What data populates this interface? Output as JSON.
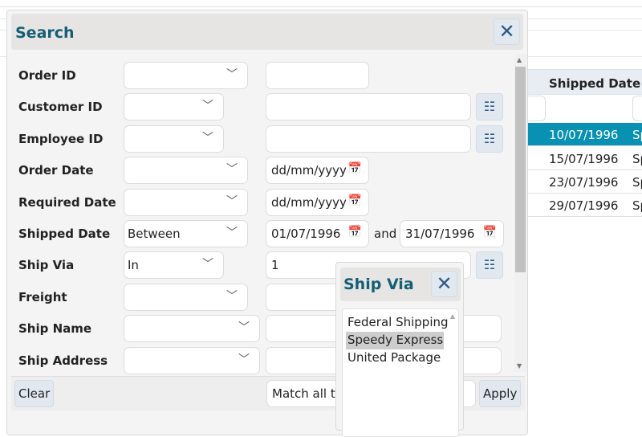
{
  "grid": {
    "header": "Shipped Date Sh",
    "rows": [
      {
        "shipped": "10/07/1996",
        "via": "Sp",
        "selected": true
      },
      {
        "shipped": "15/07/1996",
        "via": "Sp"
      },
      {
        "shipped": "23/07/1996",
        "via": "Sp"
      },
      {
        "shipped": "29/07/1996",
        "via": "Sp"
      }
    ],
    "selected_color": "#0891b2"
  },
  "search": {
    "title": "Search",
    "close_icon": "close-icon",
    "fields": [
      {
        "label": "Order ID",
        "operator": "",
        "value": ""
      },
      {
        "label": "Customer ID",
        "operator": "",
        "value": ""
      },
      {
        "label": "Employee ID",
        "operator": "",
        "value": ""
      },
      {
        "label": "Order Date",
        "operator": "",
        "value": "dd/mm/yyyy"
      },
      {
        "label": "Required Date",
        "operator": "",
        "value": "dd/mm/yyyy"
      },
      {
        "label": "Shipped Date",
        "operator": "Between",
        "value": "01/07/1996",
        "and_label": "and",
        "value2": "31/07/1996"
      },
      {
        "label": "Ship Via",
        "operator": "In",
        "value": "1"
      },
      {
        "label": "Freight",
        "operator": "",
        "value": ""
      },
      {
        "label": "Ship Name",
        "operator": "",
        "value": ""
      },
      {
        "label": "Ship Address",
        "operator": "",
        "value": ""
      }
    ],
    "footer": {
      "clear": "Clear",
      "match": "Match all th",
      "apply": "Apply"
    }
  },
  "shipvia_popup": {
    "title": "Ship Via",
    "options": [
      {
        "label": "Federal Shipping",
        "selected": false
      },
      {
        "label": "Speedy Express",
        "selected": true
      },
      {
        "label": "United Package",
        "selected": false
      }
    ]
  }
}
